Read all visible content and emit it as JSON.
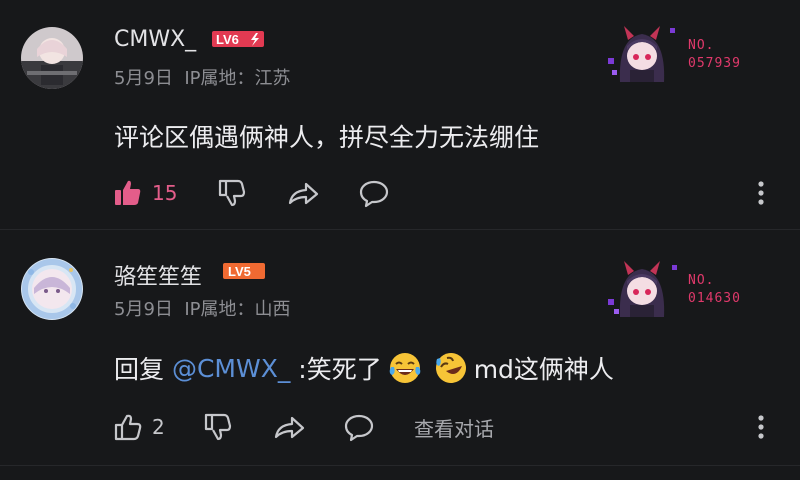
{
  "comments": [
    {
      "username": "CMWX_",
      "level": "LV6",
      "date": "5月9日",
      "ip": "IP属地：江苏",
      "text": "评论区偶遇俩神人，拼尽全力无法绷住",
      "likes": "15",
      "liked": true,
      "badge_label": "NO.",
      "badge_number": "057939",
      "icons": [
        "thumbs-up-filled-icon",
        "thumbs-down-icon",
        "share-icon",
        "comment-icon",
        "more-vertical-icon"
      ]
    },
    {
      "username": "骆笙笙笙",
      "level": "LV5",
      "date": "5月9日",
      "ip": "IP属地：山西",
      "reply_prefix": "回复 ",
      "mention": "@CMWX_",
      "text_a": " :笑死了",
      "text_b": "md这俩神人",
      "likes": "2",
      "liked": false,
      "reply_link": "查看对话",
      "badge_label": "NO.",
      "badge_number": "014630",
      "icons": [
        "thumbs-up-icon",
        "thumbs-down-icon",
        "share-icon",
        "comment-icon",
        "more-vertical-icon"
      ],
      "emojis": [
        "laughing-tears-emoji-icon",
        "rofl-emoji-icon"
      ]
    }
  ],
  "colors": {
    "background": "#17181a",
    "level6": "#e23a52",
    "level5": "#f06a32",
    "liked": "#e35d8a",
    "mention": "#5c8fd6",
    "badge_number": "#e0396b"
  }
}
